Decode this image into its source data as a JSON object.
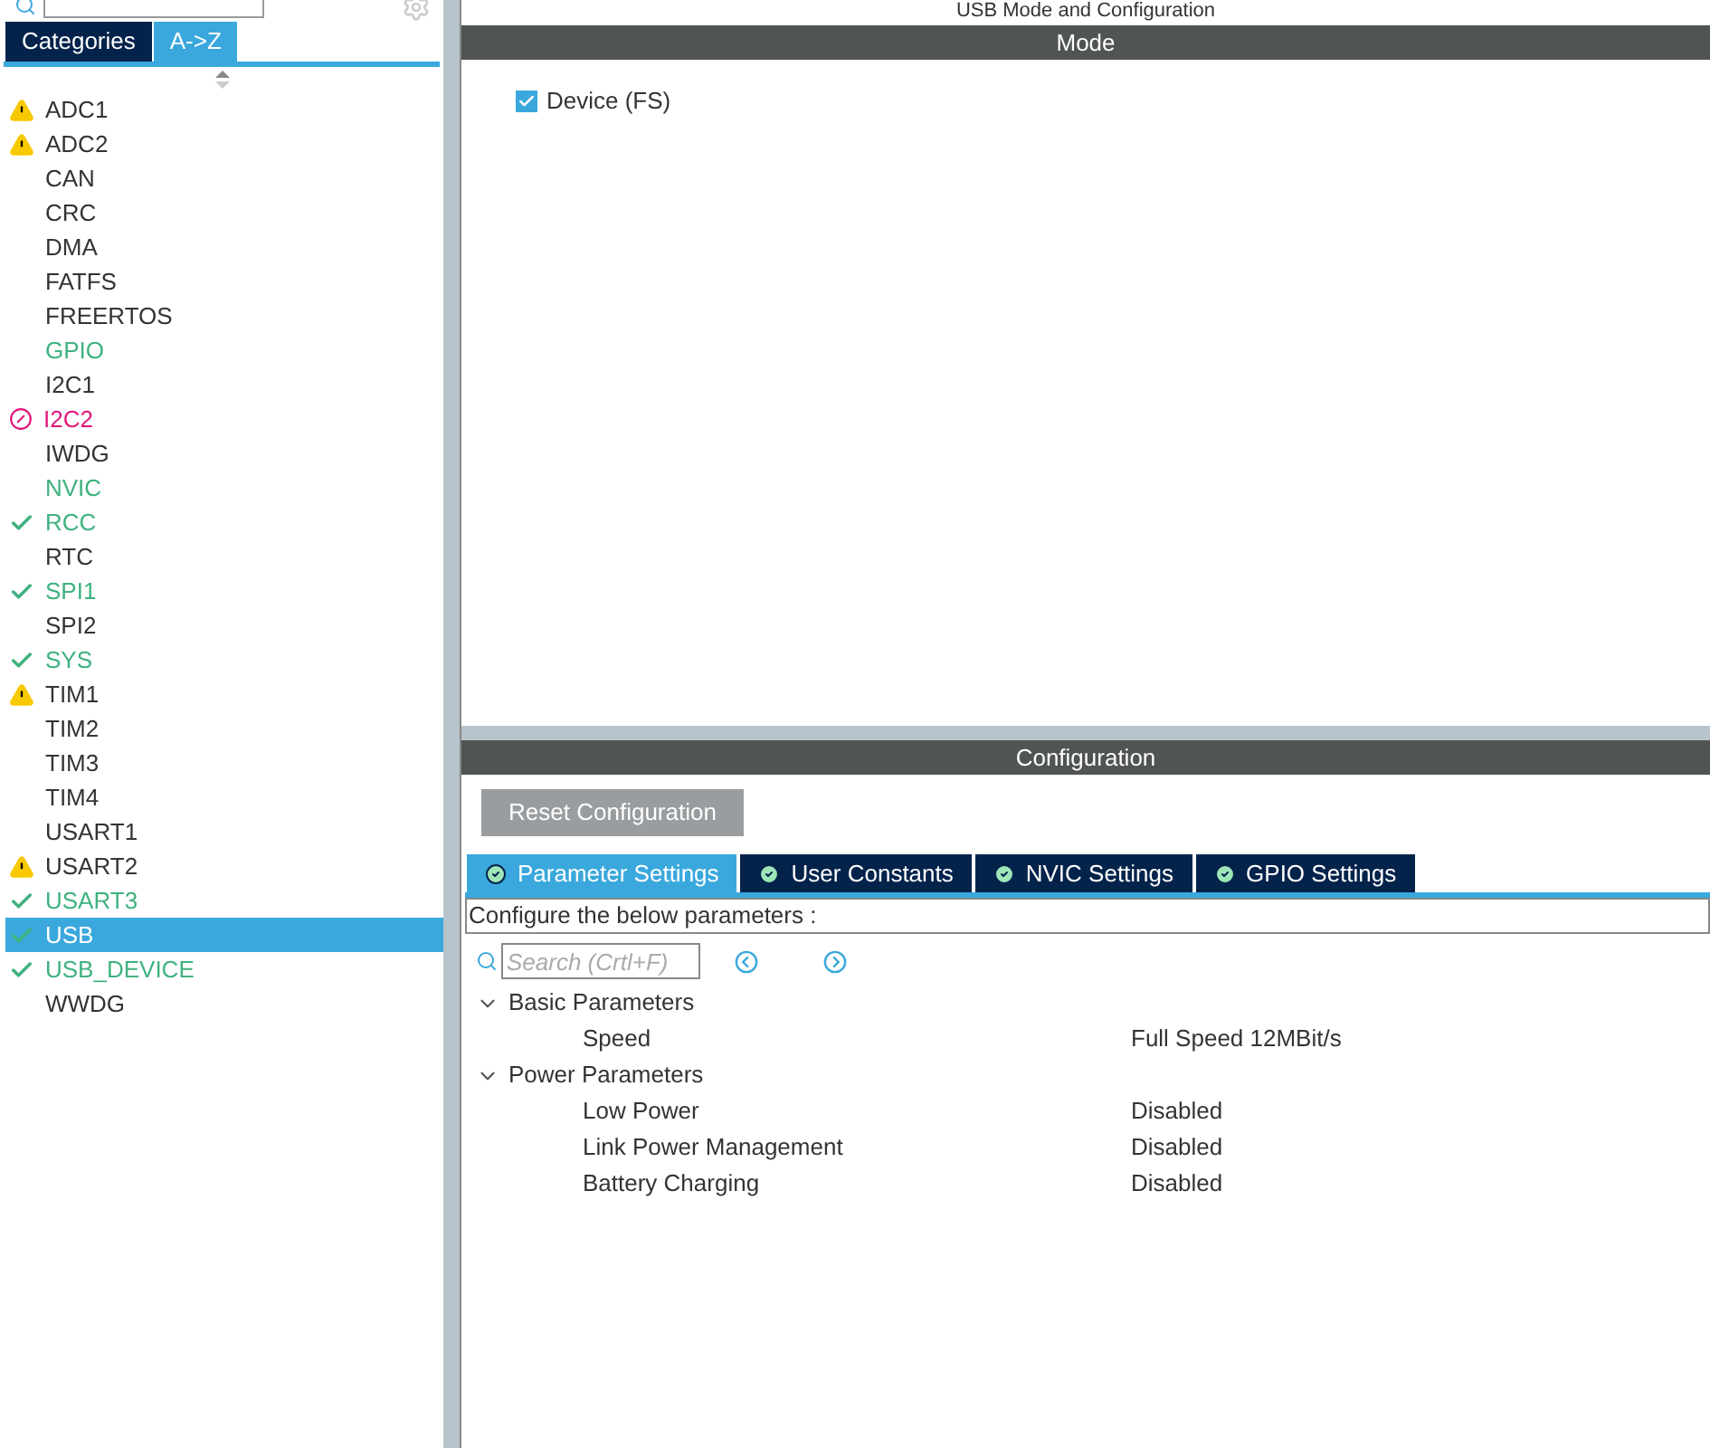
{
  "sidebar": {
    "tabs": [
      {
        "label": "Categories",
        "selected": false
      },
      {
        "label": "A->Z",
        "selected": true
      }
    ],
    "items": [
      {
        "label": "ADC1",
        "kind": "warning",
        "selected": false
      },
      {
        "label": "ADC2",
        "kind": "warning",
        "selected": false
      },
      {
        "label": "CAN",
        "kind": "none",
        "selected": false
      },
      {
        "label": "CRC",
        "kind": "none",
        "selected": false
      },
      {
        "label": "DMA",
        "kind": "none",
        "selected": false
      },
      {
        "label": "FATFS",
        "kind": "none",
        "selected": false
      },
      {
        "label": "FREERTOS",
        "kind": "none",
        "selected": false
      },
      {
        "label": "GPIO",
        "kind": "configured",
        "selected": false
      },
      {
        "label": "I2C1",
        "kind": "none",
        "selected": false
      },
      {
        "label": "I2C2",
        "kind": "error",
        "selected": false
      },
      {
        "label": "IWDG",
        "kind": "none",
        "selected": false
      },
      {
        "label": "NVIC",
        "kind": "configured",
        "selected": false
      },
      {
        "label": "RCC",
        "kind": "ok",
        "selected": false
      },
      {
        "label": "RTC",
        "kind": "none",
        "selected": false
      },
      {
        "label": "SPI1",
        "kind": "ok",
        "selected": false
      },
      {
        "label": "SPI2",
        "kind": "none",
        "selected": false
      },
      {
        "label": "SYS",
        "kind": "ok",
        "selected": false
      },
      {
        "label": "TIM1",
        "kind": "warning",
        "selected": false
      },
      {
        "label": "TIM2",
        "kind": "none",
        "selected": false
      },
      {
        "label": "TIM3",
        "kind": "none",
        "selected": false
      },
      {
        "label": "TIM4",
        "kind": "none",
        "selected": false
      },
      {
        "label": "USART1",
        "kind": "none",
        "selected": false
      },
      {
        "label": "USART2",
        "kind": "warning",
        "selected": false
      },
      {
        "label": "USART3",
        "kind": "ok",
        "selected": false
      },
      {
        "label": "USB",
        "kind": "ok",
        "selected": true
      },
      {
        "label": "USB_DEVICE",
        "kind": "ok",
        "selected": false
      },
      {
        "label": "WWDG",
        "kind": "none",
        "selected": false
      }
    ]
  },
  "main": {
    "title": "USB Mode and Configuration",
    "mode": {
      "header": "Mode",
      "options": [
        {
          "label": "Device (FS)",
          "checked": true
        }
      ]
    },
    "configuration": {
      "header": "Configuration",
      "reset_button": "Reset Configuration",
      "tabs": [
        {
          "label": "Parameter Settings",
          "selected": true
        },
        {
          "label": "User Constants",
          "selected": false
        },
        {
          "label": "NVIC Settings",
          "selected": false
        },
        {
          "label": "GPIO Settings",
          "selected": false
        }
      ],
      "description": "Configure the below parameters :",
      "search": {
        "placeholder": "Search (Crtl+F)"
      },
      "groups": [
        {
          "label": "Basic Parameters",
          "expanded": true,
          "children": [
            {
              "name": "Speed",
              "value": "Full Speed 12MBit/s"
            }
          ]
        },
        {
          "label": "Power Parameters",
          "expanded": true,
          "children": [
            {
              "name": "Low Power",
              "value": "Disabled"
            },
            {
              "name": "Link Power Management",
              "value": "Disabled"
            },
            {
              "name": "Battery Charging",
              "value": "Disabled"
            }
          ]
        }
      ]
    }
  }
}
